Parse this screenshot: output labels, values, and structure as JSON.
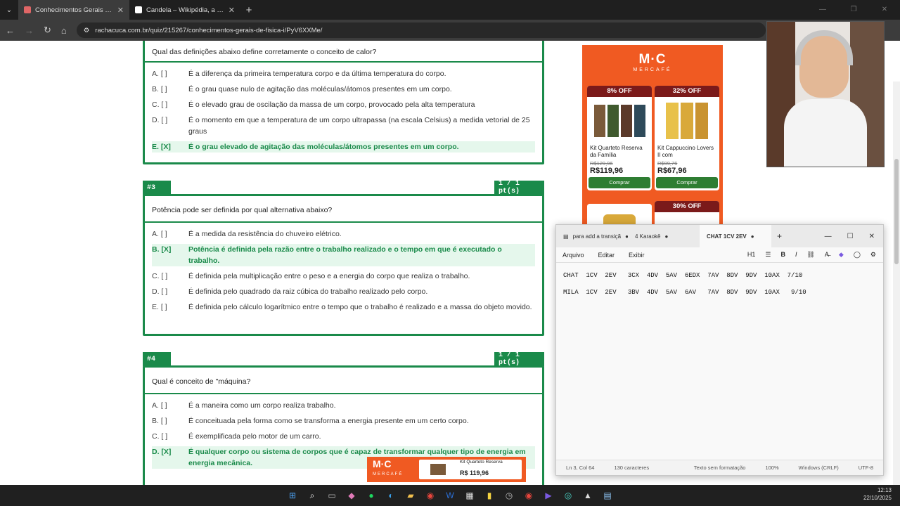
{
  "browser": {
    "tabs": [
      {
        "title": "Conhecimentos Gerais de Física"
      },
      {
        "title": "Candela – Wikipédia, a enciclopédia livre"
      }
    ],
    "url": "rachacuca.com.br/quiz/215267/conhecimentos-gerais-de-fisica-i/PyV6XXMe/"
  },
  "quiz": {
    "q2": {
      "question": "Qual das definições abaixo define corretamente o conceito de calor?",
      "options": [
        {
          "letter": "A. [ ]",
          "text": "É a diferença da primeira temperatura corpo e da última temperatura do corpo."
        },
        {
          "letter": "B. [ ]",
          "text": "É o grau quase nulo de agitação das moléculas/átomos presentes em um corpo."
        },
        {
          "letter": "C. [ ]",
          "text": "É o elevado grau de oscilação da massa de um corpo, provocado pela alta temperatura"
        },
        {
          "letter": "D. [ ]",
          "text": "É o momento em que a temperatura de um corpo ultrapassa (na escala Celsius) a medida vetorial de 25 graus"
        },
        {
          "letter": "E. [X]",
          "text": "É o grau elevado de agitação das moléculas/átomos presentes em um corpo."
        }
      ]
    },
    "q3": {
      "number": "#3",
      "score": "1 / 1 pt(s)",
      "question": "Potência pode ser definida por qual alternativa abaixo?",
      "options": [
        {
          "letter": "A. [ ]",
          "text": "É a medida da resistência do chuveiro elétrico."
        },
        {
          "letter": "B. [X]",
          "text": "Potência é definida pela razão entre o trabalho realizado e o tempo em que é executado o trabalho."
        },
        {
          "letter": "C. [ ]",
          "text": "É definida pela multiplicação entre o peso e a energia do corpo que realiza o trabalho."
        },
        {
          "letter": "D. [ ]",
          "text": "É definida pelo quadrado da raiz cúbica do trabalho realizado pelo corpo."
        },
        {
          "letter": "E. [ ]",
          "text": "É definida pelo cálculo logarítmico entre o tempo que o trabalho é realizado e a massa do objeto movido."
        }
      ]
    },
    "q4": {
      "number": "#4",
      "score": "1 / 1 pt(s)",
      "question": "Qual é conceito de \"máquina?",
      "options": [
        {
          "letter": "A. [ ]",
          "text": "É a maneira como um corpo realiza trabalho."
        },
        {
          "letter": "B. [ ]",
          "text": "É conceituada pela forma como se transforma a energia presente em um certo corpo."
        },
        {
          "letter": "C. [ ]",
          "text": "É exemplificada pelo motor de um carro."
        },
        {
          "letter": "D. [X]",
          "text": "É qualquer corpo ou sistema de corpos que é capaz de transformar qualquer tipo de energia em energia mecânica."
        }
      ]
    }
  },
  "ad": {
    "logo": "M·C",
    "brand": "MERCAFÉ",
    "products": [
      {
        "discount": "8% OFF",
        "name": "Kit Quarteto Reserva da Família",
        "old_price": "R$129,96",
        "price": "R$119,96",
        "buy": "Comprar"
      },
      {
        "discount": "32% OFF",
        "name": "Kit Cappuccino Lovers II com",
        "old_price": "R$99,76",
        "price": "R$67,96",
        "buy": "Comprar"
      }
    ],
    "third_discount": "30% OFF",
    "bottom": {
      "logo": "M·C",
      "brand": "MERCAFÉ",
      "name": "Kit Quarteto Reserva",
      "price": "R$ 119,96"
    }
  },
  "notepad": {
    "tabs": [
      "para add a transiçã",
      "4 Karaokê",
      "CHAT 1CV 2EV"
    ],
    "menu": [
      "Arquivo",
      "Editar",
      "Exibir"
    ],
    "heading": "H1",
    "lines": [
      "CHAT  1CV  2EV   3CX  4DV  5AV  6EDX  7AV  8DV  9DV  10AX  7/10",
      "MILA  1CV  2EV   3BV  4DV  5AV  6AV   7AV  8DV  9DV  10AX   9/10"
    ],
    "status": {
      "position": "Ln 3, Col 64",
      "chars": "130 caracteres",
      "format": "Texto sem formatação",
      "zoom": "100%",
      "eol": "Windows (CRLF)",
      "encoding": "UTF-8"
    }
  },
  "clock": {
    "time": "12:13",
    "date": "22/10/2025"
  }
}
